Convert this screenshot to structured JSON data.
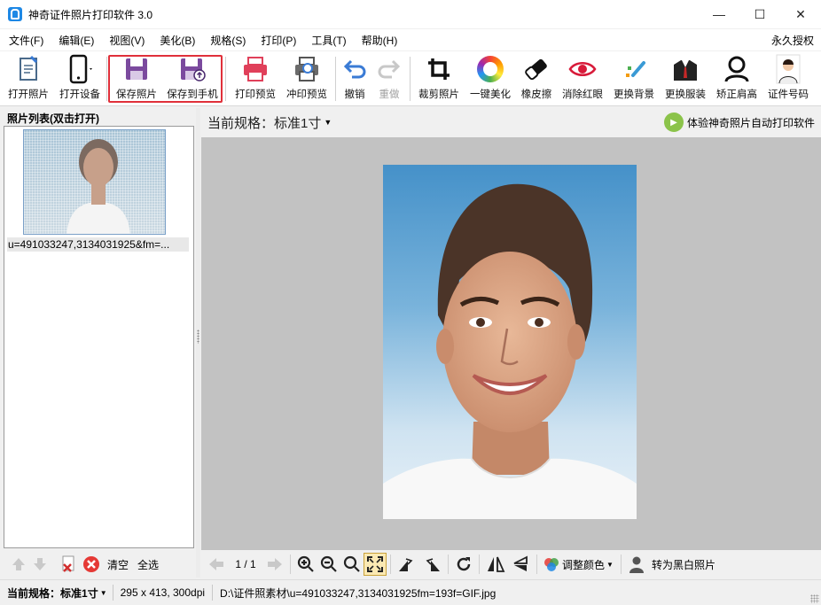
{
  "window": {
    "title": "神奇证件照片打印软件 3.0",
    "minimize": "—",
    "maximize": "☐",
    "close": "✕"
  },
  "menu": {
    "items": [
      "文件(F)",
      "编辑(E)",
      "视图(V)",
      "美化(B)",
      "规格(S)",
      "打印(P)",
      "工具(T)",
      "帮助(H)"
    ],
    "license": "永久授权"
  },
  "toolbar": {
    "open_photo": "打开照片",
    "open_device": "打开设备",
    "save_photo": "保存照片",
    "save_to_phone": "保存到手机",
    "print_preview": "打印预览",
    "develop_preview": "冲印预览",
    "undo": "撤销",
    "redo": "重做",
    "crop": "裁剪照片",
    "beautify": "一键美化",
    "eraser": "橡皮擦",
    "red_eye": "消除红眼",
    "change_bg": "更换背景",
    "change_clothes": "更换服装",
    "shoulder": "矫正肩高",
    "id_number": "证件号码"
  },
  "left_panel": {
    "header": "照片列表(双击打开)",
    "thumb_caption": "u=491033247,3134031925&fm=...",
    "clear": "清空",
    "select_all": "全选"
  },
  "right_panel": {
    "spec_prefix": "当前规格：",
    "spec_value": "标准1寸",
    "promo": "体验神奇照片自动打印软件"
  },
  "bottom_tools": {
    "page": "1 / 1",
    "adjust_color": "调整颜色",
    "to_bw": "转为黑白照片"
  },
  "status": {
    "spec_label": "当前规格：",
    "spec_value": "标准1寸",
    "size": "295 x 413, 300dpi",
    "path": "D:\\证件照素材\\u=491033247,3134031925fm=193f=GIF.jpg"
  },
  "colors": {
    "highlight": "#e0303a",
    "save_icon": "#7b4a9e",
    "print_icon": "#e0405a",
    "undo_icon": "#3a7bd5"
  }
}
